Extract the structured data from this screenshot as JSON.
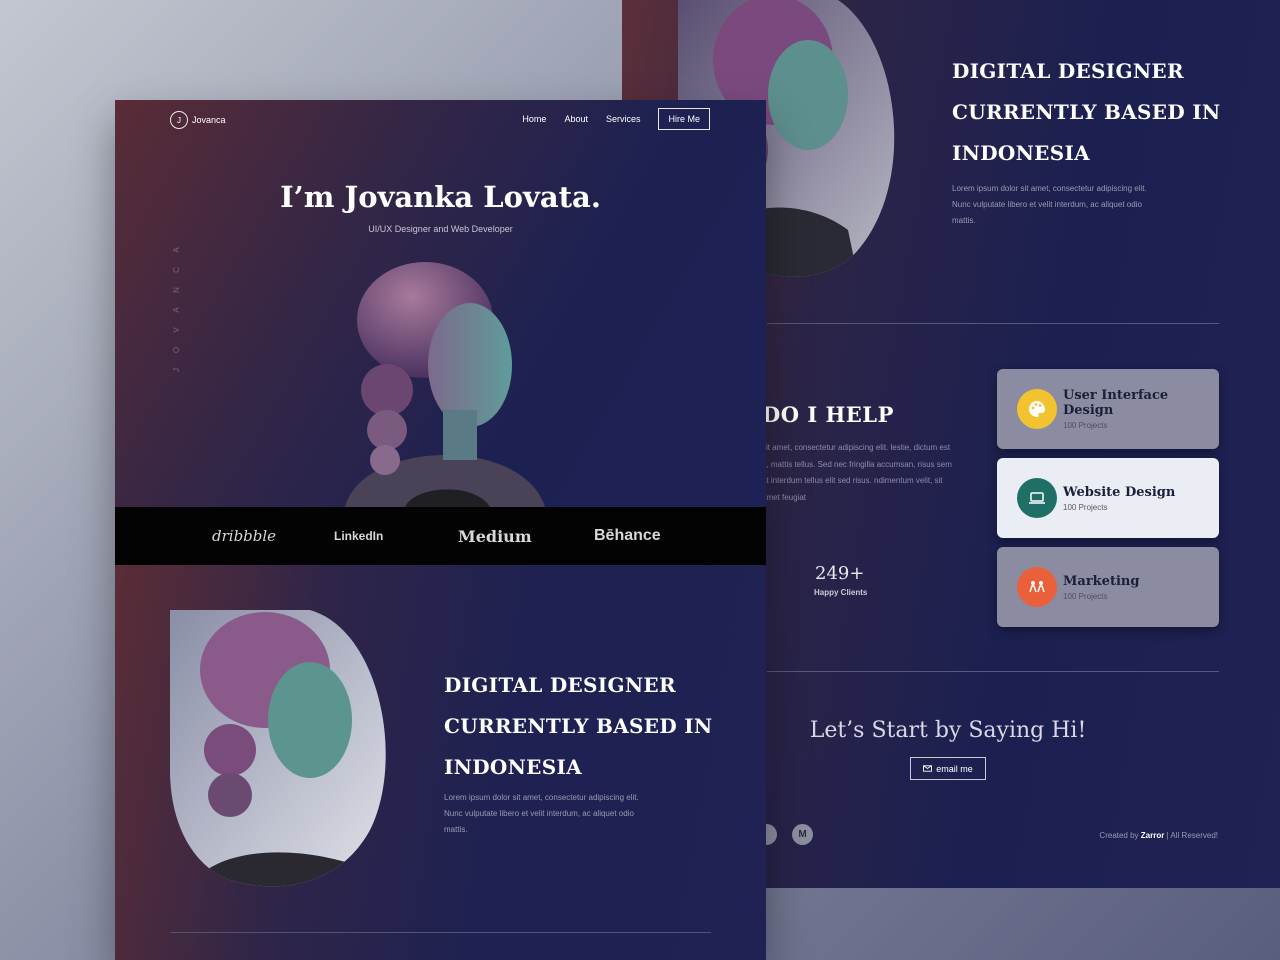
{
  "brand": {
    "initial": "J",
    "name": "Jovanca"
  },
  "nav": {
    "links": [
      "Home",
      "About",
      "Services"
    ],
    "hire_label": "Hire Me"
  },
  "hero": {
    "title": "I’m Jovanka Lovata.",
    "subtitle": "UI/UX Designer and Web Developer",
    "vertical_name": "JOVANCA"
  },
  "logos": [
    "dribbble",
    "LinkedIn",
    "Medium",
    "Bēhance"
  ],
  "about": {
    "heading_lines": [
      "DIGITAL DESIGNER",
      "CURRENTLY BASED IN",
      "INDONESIA"
    ],
    "description": "Lorem ipsum dolor sit amet, consectetur adipiscing elit. Nunc vulputate libero et velit interdum, ac aliquet odio mattis."
  },
  "help": {
    "title_visible": "DO I HELP",
    "text_visible": "sit amet, consectetur adipiscing elit. lestie, dictum est a, mattis tellus. Sed nec fringilla accumsan, risus sem at interdum tellus elit sed risus. ndimentum velit, sit amet feugiat",
    "stat_number": "249+",
    "stat_label": "Happy Clients"
  },
  "services": [
    {
      "title": "User Interface Design",
      "count": "100 Projects",
      "icon": "palette-icon",
      "color": "#f3c22f"
    },
    {
      "title": "Website Design",
      "count": "100 Projects",
      "icon": "laptop-icon",
      "color": "#1f6f66"
    },
    {
      "title": "Marketing",
      "count": "100 Projects",
      "icon": "people-icon",
      "color": "#e9603b"
    }
  ],
  "contact": {
    "cta": "Let’s Start by Saying Hi!",
    "email_label": "email me"
  },
  "social_icons": [
    "dribbble-icon",
    "medium-icon"
  ],
  "social_medium_letter": "M",
  "footer": {
    "prefix": "Created by ",
    "author": "Zarror",
    "suffix": " | All Reserved!"
  },
  "colors": {
    "navy": "#1d2152",
    "maroon": "#5a2c36",
    "bar": "#030303"
  }
}
